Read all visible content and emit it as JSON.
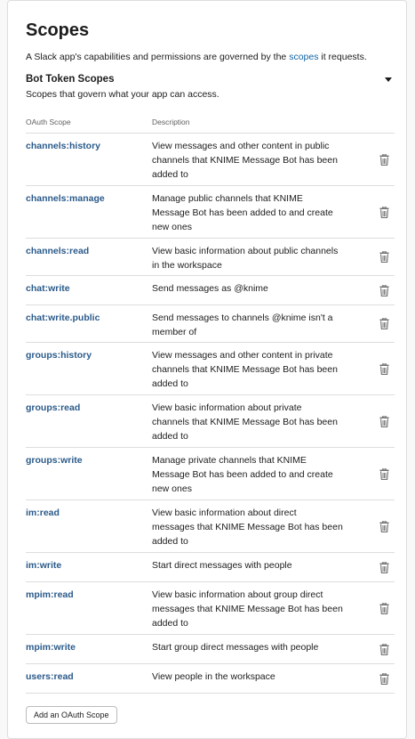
{
  "page": {
    "title": "Scopes",
    "intro_before": "A Slack app's capabilities and permissions are governed by the ",
    "intro_link": "scopes",
    "intro_after": " it requests."
  },
  "section": {
    "title": "Bot Token Scopes",
    "subtitle": "Scopes that govern what your app can access."
  },
  "table": {
    "headers": {
      "scope": "OAuth Scope",
      "description": "Description"
    },
    "rows": [
      {
        "scope": "channels:history",
        "lines": [
          "View messages and other content in public",
          "channels that KNIME Message Bot has been",
          "added to"
        ]
      },
      {
        "scope": "channels:manage",
        "lines": [
          "Manage public channels that KNIME",
          "Message Bot has been added to and create",
          "new ones"
        ]
      },
      {
        "scope": "channels:read",
        "lines": [
          "View basic information about public channels",
          "in the workspace"
        ]
      },
      {
        "scope": "chat:write",
        "lines": [
          "Send messages as @knime"
        ]
      },
      {
        "scope": "chat:write.public",
        "lines": [
          "Send messages to channels @knime isn't a",
          "member of"
        ]
      },
      {
        "scope": "groups:history",
        "lines": [
          "View messages and other content in private",
          "channels that KNIME Message Bot has been",
          "added to"
        ]
      },
      {
        "scope": "groups:read",
        "lines": [
          "View basic information about private",
          "channels that KNIME Message Bot has been",
          "added to"
        ]
      },
      {
        "scope": "groups:write",
        "lines": [
          "Manage private channels that KNIME",
          "Message Bot has been added to and create",
          "new ones"
        ]
      },
      {
        "scope": "im:read",
        "lines": [
          "View basic information about direct",
          "messages that KNIME Message Bot has been",
          "added to"
        ]
      },
      {
        "scope": "im:write",
        "lines": [
          "Start direct messages with people"
        ]
      },
      {
        "scope": "mpim:read",
        "lines": [
          "View basic information about group direct",
          "messages that KNIME Message Bot has been",
          "added to"
        ]
      },
      {
        "scope": "mpim:write",
        "lines": [
          "Start group direct messages with people"
        ]
      },
      {
        "scope": "users:read",
        "lines": [
          "View people in the workspace"
        ]
      }
    ]
  },
  "add_button": {
    "label": "Add an OAuth Scope"
  },
  "icons": {
    "delete": "trash-icon",
    "collapse": "caret-down-icon"
  },
  "colors": {
    "link": "#1264a3",
    "scope_name": "#2a5a8a",
    "border": "#dddddd"
  }
}
